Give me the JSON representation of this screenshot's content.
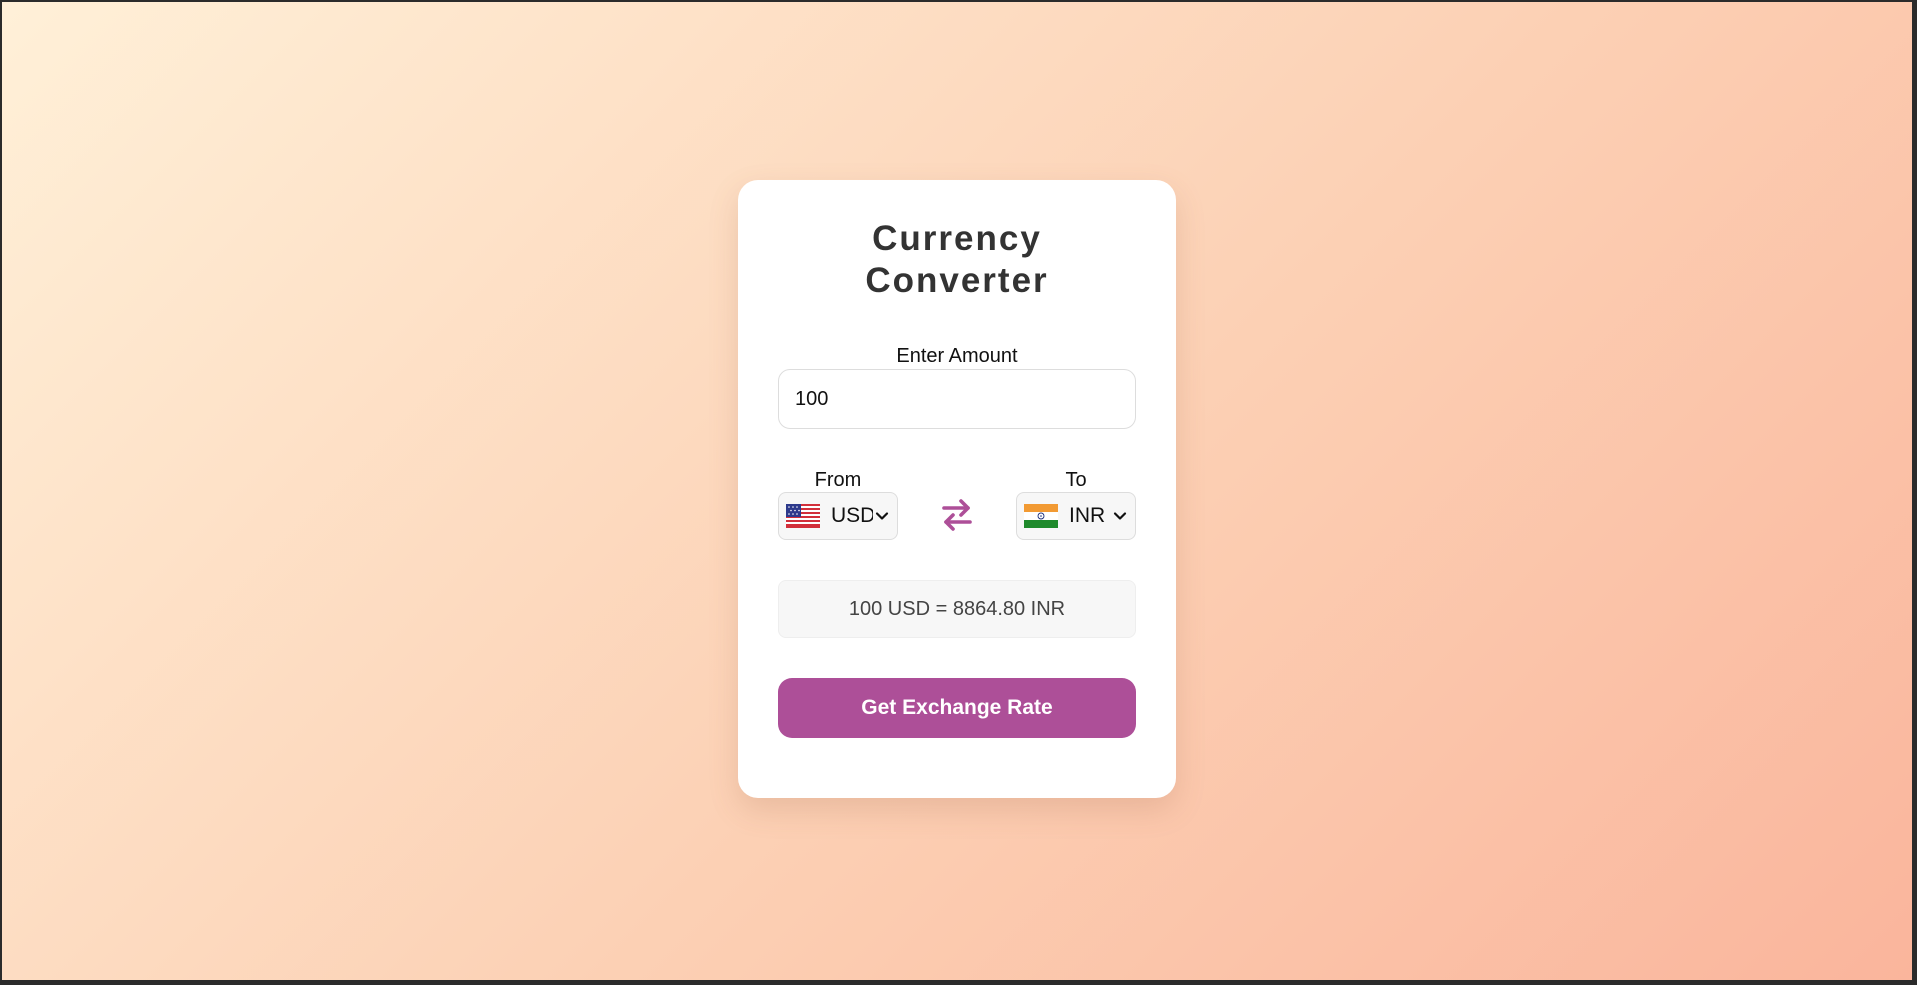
{
  "app": {
    "title_line1": "Currency",
    "title_line2": "Converter"
  },
  "amount": {
    "label": "Enter Amount",
    "value": "100"
  },
  "from": {
    "label": "From",
    "currency": "USD",
    "flag_icon": "us-flag-icon"
  },
  "to": {
    "label": "To",
    "currency": "INR",
    "flag_icon": "india-flag-icon"
  },
  "result": {
    "text": "100 USD = 8864.80 INR"
  },
  "button": {
    "label": "Get Exchange Rate"
  },
  "colors": {
    "accent": "#ad4f98",
    "background_start": "#fff0d8",
    "background_end": "#fab59c",
    "card": "#ffffff",
    "title_text": "#333333"
  }
}
